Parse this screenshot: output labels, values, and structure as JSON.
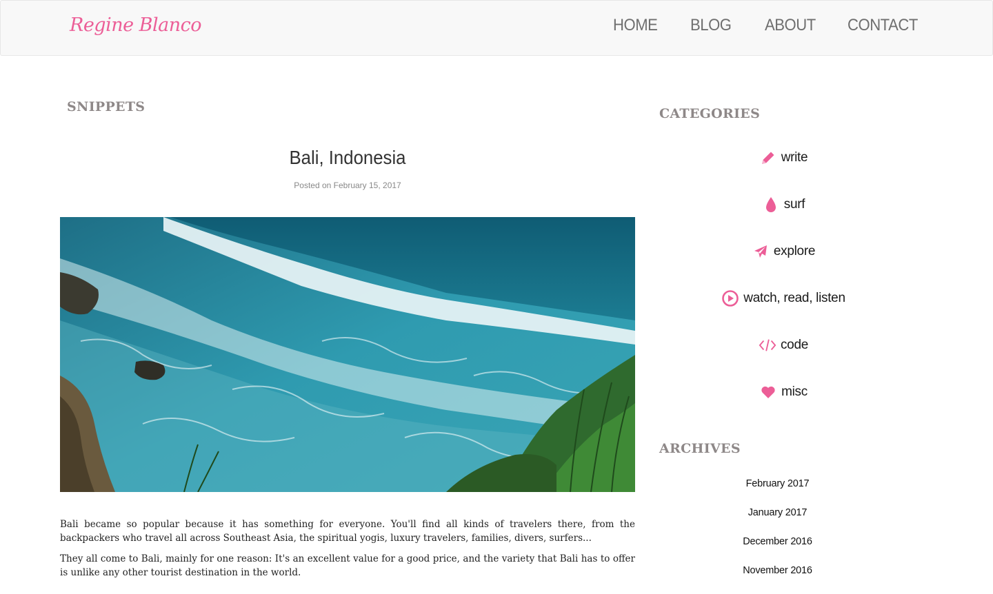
{
  "brand": {
    "name": "Regine Blanco",
    "color": "#ec5e97"
  },
  "nav": {
    "items": [
      {
        "label": "HOME"
      },
      {
        "label": "BLOG"
      },
      {
        "label": "ABOUT"
      },
      {
        "label": "CONTACT"
      }
    ]
  },
  "main": {
    "section_heading": "SNIPPETS",
    "post": {
      "title": "Bali, Indonesia",
      "meta": "Posted on February 15, 2017",
      "image_subject": "aerial view of turquoise ocean waves crashing on rocky cliffs with green foliage",
      "paragraphs": [
        "Bali became so popular because it has something for everyone. You'll find all kinds of travelers there, from the backpackers who travel all across Southeast Asia, the spiritual yogis, luxury travelers, families, divers, surfers...",
        "They all come to Bali, mainly for one reason: It's an excellent value for a good price, and the variety that Bali has to offer is unlike any other tourist destination in the world."
      ]
    }
  },
  "sidebar": {
    "categories_heading": "CATEGORIES",
    "categories": [
      {
        "label": "write",
        "icon": "pencil-icon"
      },
      {
        "label": "surf",
        "icon": "drop-icon"
      },
      {
        "label": "explore",
        "icon": "plane-icon"
      },
      {
        "label": "watch, read, listen",
        "icon": "play-icon"
      },
      {
        "label": "code",
        "icon": "code-icon"
      },
      {
        "label": "misc",
        "icon": "heart-icon"
      }
    ],
    "archives_heading": "ARCHIVES",
    "archives": [
      {
        "label": "February 2017"
      },
      {
        "label": "January 2017"
      },
      {
        "label": "December 2016"
      },
      {
        "label": "November 2016"
      }
    ]
  },
  "colors": {
    "accent": "#ec5e97",
    "heading": "#8e8888",
    "nav_text": "#6f6f6f"
  }
}
